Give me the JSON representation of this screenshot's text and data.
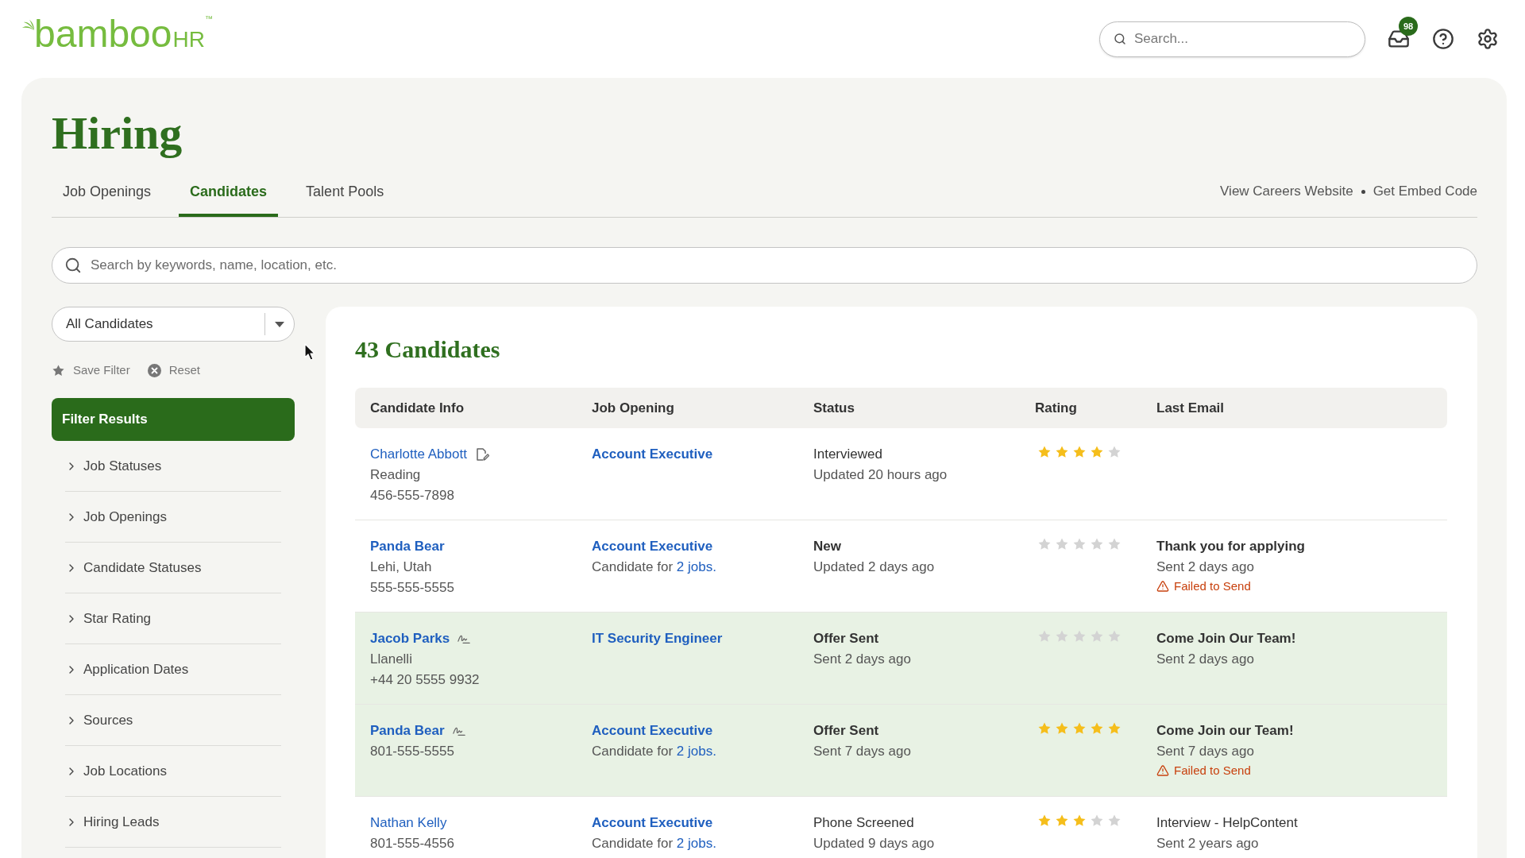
{
  "header": {
    "logo": {
      "wordmark": "bamboo",
      "suffix": "HR",
      "trademark": "™"
    },
    "search": {
      "placeholder": "Search..."
    },
    "inbox": {
      "badge": "98"
    }
  },
  "page": {
    "title": "Hiring"
  },
  "tabs": [
    {
      "label": "Job Openings",
      "selected": false
    },
    {
      "label": "Candidates",
      "selected": true
    },
    {
      "label": "Talent Pools",
      "selected": false
    }
  ],
  "page_links": [
    {
      "label": "View Careers Website"
    },
    {
      "label": "Get Embed Code"
    }
  ],
  "search": {
    "placeholder": "Search by keywords, name, location, etc."
  },
  "sidebar": {
    "filter_select": {
      "value": "All Candidates"
    },
    "actions": [
      {
        "kind": "save",
        "label": "Save Filter"
      },
      {
        "kind": "reset",
        "label": "Reset"
      }
    ],
    "filter_button": "Filter Results",
    "filters": [
      {
        "label": "Job Statuses",
        "expanded": false
      },
      {
        "label": "Job Openings",
        "expanded": false
      },
      {
        "label": "Candidate Statuses",
        "expanded": false
      },
      {
        "label": "Star Rating",
        "expanded": false
      },
      {
        "label": "Application Dates",
        "expanded": false
      },
      {
        "label": "Sources",
        "expanded": false
      },
      {
        "label": "Job Locations",
        "expanded": false
      },
      {
        "label": "Hiring Leads",
        "expanded": false
      }
    ]
  },
  "results": {
    "title": "43 Candidates",
    "table": {
      "columns": [
        "Candidate Info",
        "Job Opening",
        "Status",
        "Rating",
        "Last Email"
      ],
      "rows": [
        {
          "unread": false,
          "highlighted": false,
          "candidate": {
            "name": "Charlotte Abbott",
            "has_note": true,
            "signed": false,
            "location": "Reading",
            "phone": "456-555-7898"
          },
          "job": {
            "title": "Account Executive"
          },
          "status": {
            "label": "Interviewed",
            "updated": "Updated 20 hours ago"
          },
          "stars": 4
        },
        {
          "unread": true,
          "highlighted": false,
          "candidate": {
            "name": "Panda Bear",
            "has_note": false,
            "signed": false,
            "location": "Lehi, Utah",
            "phone": "555-555-5555"
          },
          "job": {
            "title": "Account Executive",
            "other_jobs": {
              "prefix": "Candidate for",
              "link": "2 jobs."
            }
          },
          "status": {
            "label": "New",
            "updated": "Updated 2 days ago"
          },
          "stars": 0,
          "last_email": {
            "subject": "Thank you for applying",
            "sent": "Sent 2 days ago",
            "error": "Failed to Send"
          }
        },
        {
          "unread": true,
          "highlighted": true,
          "candidate": {
            "name": "Jacob Parks",
            "has_note": false,
            "signed": true,
            "location": "Llanelli",
            "phone": "+44 20 5555 9932"
          },
          "job": {
            "title": "IT Security Engineer"
          },
          "status": {
            "label": "Offer Sent",
            "updated": "Sent 2 days ago"
          },
          "stars": 0,
          "last_email": {
            "subject": "Come Join Our Team!",
            "sent": "Sent 2 days ago"
          }
        },
        {
          "unread": true,
          "highlighted": true,
          "candidate": {
            "name": "Panda Bear",
            "has_note": false,
            "signed": true,
            "phone": "801-555-5555"
          },
          "job": {
            "title": "Account Executive",
            "other_jobs": {
              "prefix": "Candidate for",
              "link": "2 jobs."
            }
          },
          "status": {
            "label": "Offer Sent",
            "updated": "Sent 7 days ago"
          },
          "stars": 5,
          "last_email": {
            "subject": "Come Join our Team!",
            "sent": "Sent 7 days ago",
            "error": "Failed to Send"
          }
        },
        {
          "unread": false,
          "highlighted": false,
          "candidate": {
            "name": "Nathan Kelly",
            "has_note": false,
            "signed": false,
            "phone": "801-555-4556"
          },
          "job": {
            "title": "Account Executive",
            "other_jobs": {
              "prefix": "Candidate for",
              "link": "2 jobs."
            }
          },
          "status": {
            "label": "Phone Screened",
            "updated": "Updated 9 days ago"
          },
          "stars": 3,
          "last_email": {
            "subject": "Interview - HelpContent",
            "sent": "Sent 2 years ago"
          }
        }
      ]
    }
  }
}
